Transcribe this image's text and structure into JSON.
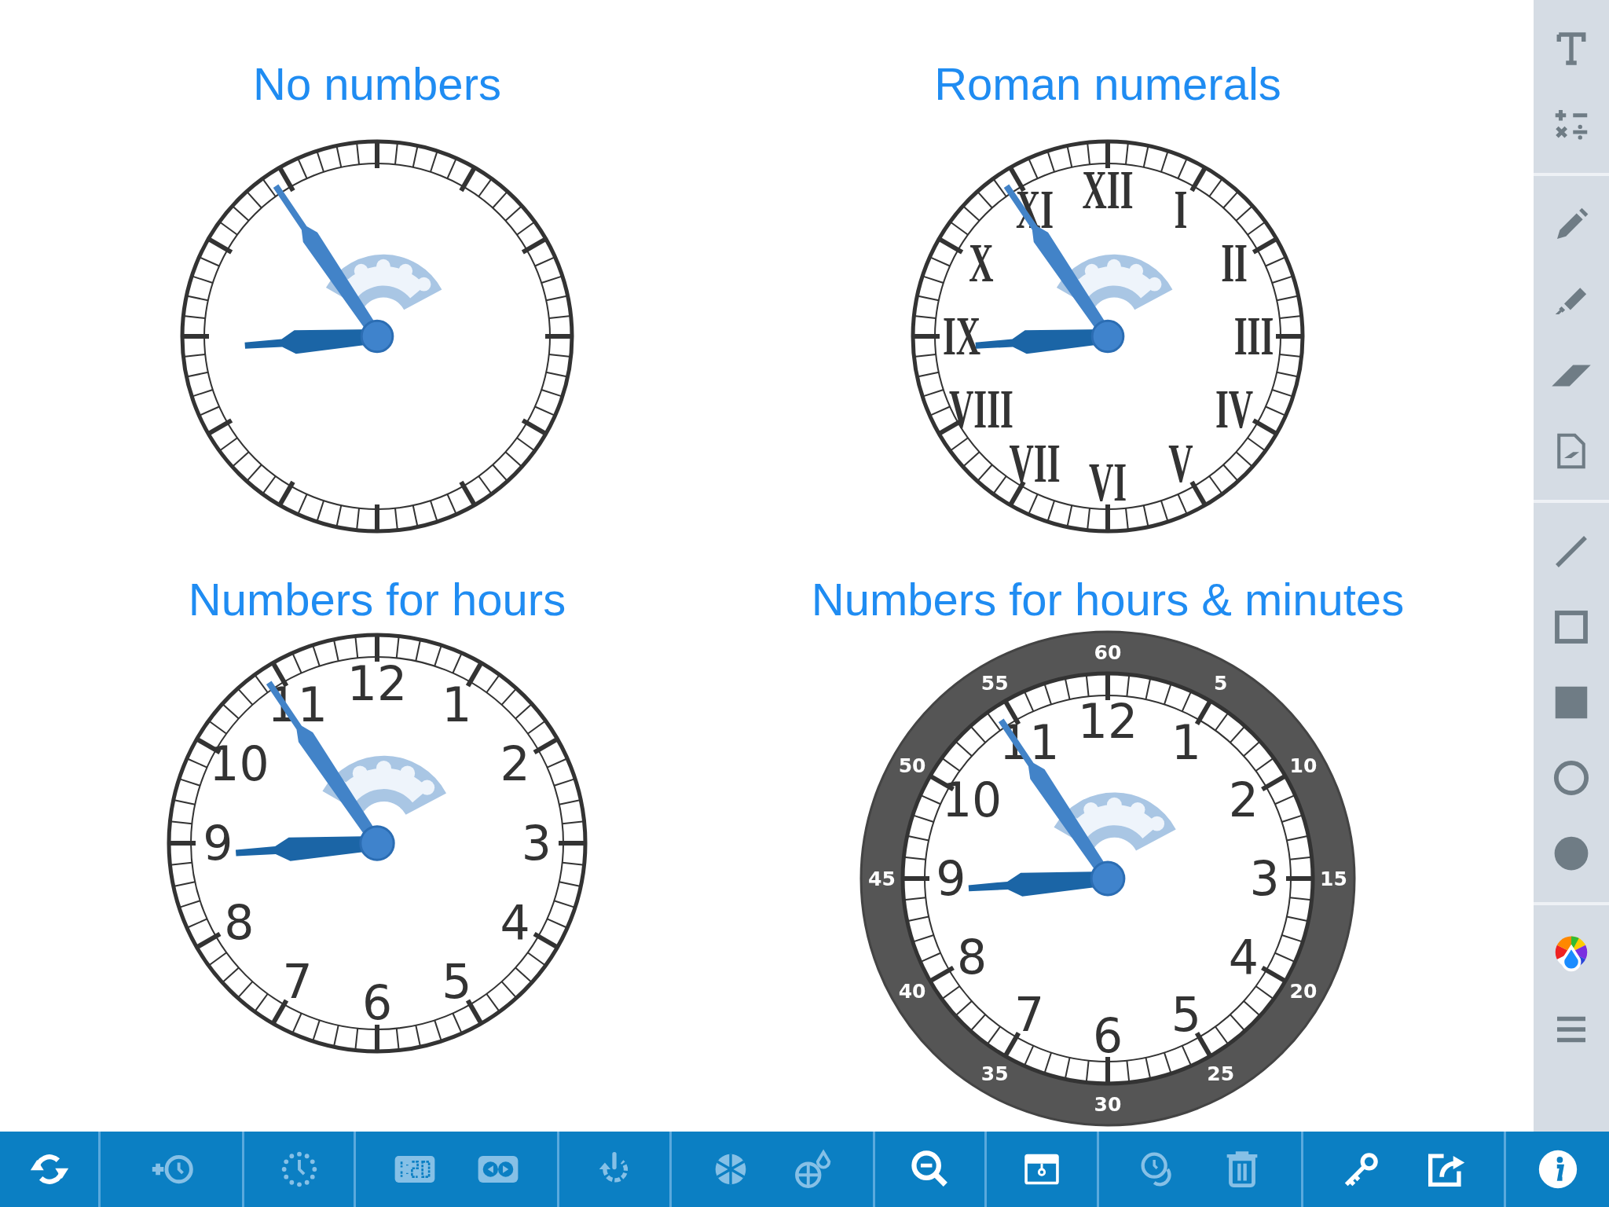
{
  "clocks": [
    {
      "kind": "plain",
      "title": "No numbers"
    },
    {
      "kind": "roman",
      "title": "Roman numerals",
      "numerals": [
        "XII",
        "XI",
        "I",
        "X",
        "II",
        "IX",
        "III",
        "VIII",
        "IV",
        "VII",
        "V",
        "VI"
      ]
    },
    {
      "kind": "hours",
      "title": "Numbers for hours",
      "numerals": [
        "12",
        "11",
        "1",
        "10",
        "2",
        "9",
        "3",
        "8",
        "4",
        "7",
        "5",
        "6"
      ]
    },
    {
      "kind": "hours_minutes",
      "title": "Numbers for hours & minutes",
      "numerals": [
        "12",
        "11",
        "1",
        "10",
        "2",
        "9",
        "3",
        "8",
        "4",
        "7",
        "5",
        "6"
      ],
      "minute_labels": [
        "60",
        "55",
        "5",
        "50",
        "10",
        "45",
        "15",
        "40",
        "20",
        "35",
        "25",
        "30"
      ]
    }
  ],
  "toolbar": {
    "groups": [
      [
        {
          "disabled": false
        }
      ],
      [
        {
          "disabled": true
        }
      ],
      [
        {
          "disabled": true
        }
      ],
      [
        {
          "disabled": true
        },
        {
          "disabled": true
        }
      ],
      [
        {
          "disabled": true
        }
      ],
      [
        {
          "disabled": true
        },
        {
          "disabled": true
        }
      ],
      [
        {
          "disabled": false
        }
      ],
      [
        {
          "disabled": false
        }
      ],
      [
        {
          "disabled": true
        },
        {
          "disabled": true
        }
      ],
      [
        {
          "disabled": false
        },
        {
          "disabled": false
        }
      ],
      [
        {
          "disabled": false
        }
      ]
    ]
  }
}
